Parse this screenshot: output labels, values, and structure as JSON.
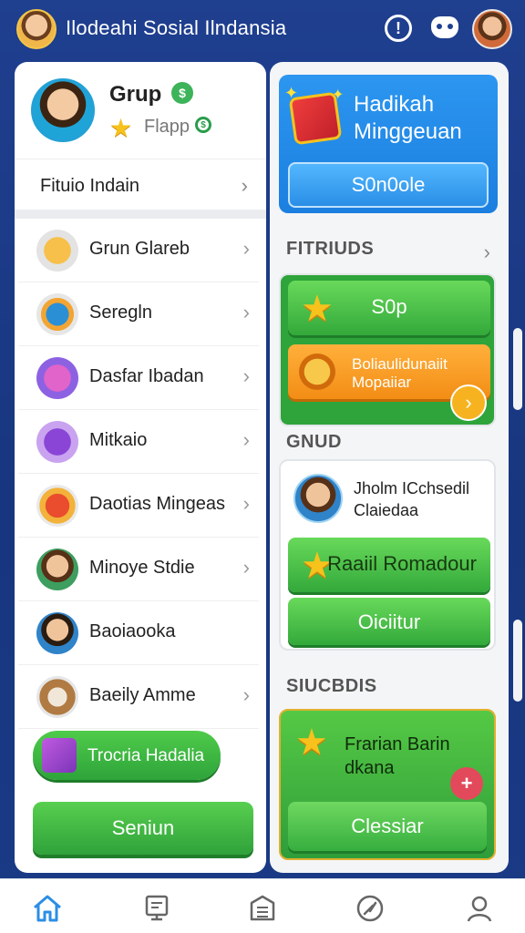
{
  "app": {
    "title": "Ilodeahi Sosial Ilndansia"
  },
  "profile": {
    "group_title": "Grup",
    "group_badge": "$",
    "subtitle": "Flapp",
    "subtitle_badge": "$"
  },
  "features_row": {
    "label": "Fituio Indain"
  },
  "list": [
    {
      "label": "Grun Glareb",
      "icon": "gift-box-icon"
    },
    {
      "label": "Seregln",
      "icon": "square-box-icon"
    },
    {
      "label": "Dasfar Ibadan",
      "icon": "pink-loop-icon"
    },
    {
      "label": "Mitkaio",
      "icon": "purple-dress-icon"
    },
    {
      "label": "Daotias Mingeas",
      "icon": "treasure-chest-icon"
    },
    {
      "label": "Minoye Stdie",
      "icon": "boy-avatar-icon"
    },
    {
      "label": "Baoiaooka",
      "icon": "boy-avatar-icon"
    },
    {
      "label": "Baeily Amme",
      "icon": "monkey-icon"
    }
  ],
  "pill_button": {
    "label": "Trocria Hadalia"
  },
  "save_button": {
    "label": "Seniun"
  },
  "promo": {
    "title_line1": "Hadikah",
    "title_line2": "Minggeuan",
    "button": "S0n0ole"
  },
  "sections": {
    "features": "FITRIUDS",
    "group": "GNUD",
    "success": "SIUCBDIS"
  },
  "feature_buttons": {
    "shop": "S0p",
    "special_line1": "Boliaulidunaiit",
    "special_line2": "Mopaiiar"
  },
  "friend": {
    "line1": "Jholm ICchsedil",
    "line2": "Claiedaa"
  },
  "group_buttons": {
    "primary": "Raaiil Romadour",
    "secondary": "Oiciitur"
  },
  "success_card": {
    "line1": "Frarian Barin",
    "line2": "dkana",
    "button": "Clessiar"
  },
  "colors": {
    "brand_blue": "#1f3f8f",
    "green": "#2ea43a",
    "orange": "#f38d15",
    "promo_blue": "#1b7fe0"
  }
}
